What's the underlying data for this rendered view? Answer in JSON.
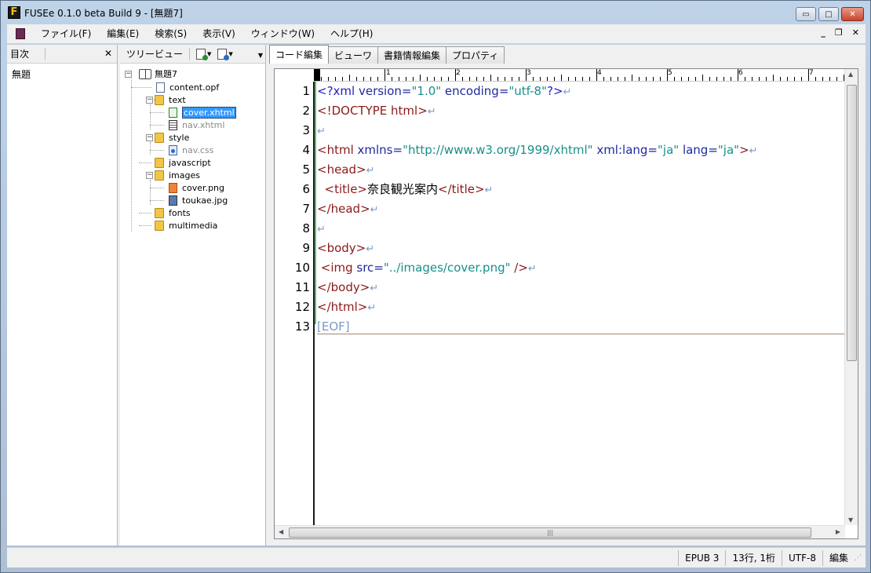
{
  "window": {
    "title": "FUSEe 0.1.0 beta Build 9 - [無題7]",
    "app_icon_letter": "F",
    "minimize_glyph": "▭",
    "maximize_glyph": "□",
    "close_glyph": "✕"
  },
  "menu": {
    "items": [
      "ファイル(F)",
      "編集(E)",
      "検索(S)",
      "表示(V)",
      "ウィンドウ(W)",
      "ヘルプ(H)"
    ],
    "mdi_min": "_",
    "mdi_restore": "❐",
    "mdi_close": "✕"
  },
  "toc": {
    "header": "目次",
    "close_glyph": "✕",
    "items": [
      "無題"
    ]
  },
  "tree": {
    "header": "ツリービュー",
    "root": "無題7",
    "nodes": {
      "content": "content.opf",
      "text": "text",
      "cover": "cover.xhtml",
      "nav": "nav.xhtml",
      "style": "style",
      "navcss": "nav.css",
      "javascript": "javascript",
      "images": "images",
      "coverpng": "cover.png",
      "toukae": "toukae.jpg",
      "fonts": "fonts",
      "multimedia": "multimedia"
    }
  },
  "tabs": [
    "コード編集",
    "ビューワ",
    "書籍情報編集",
    "プロパティ"
  ],
  "editor": {
    "ruler_marks": [
      "1",
      "2",
      "3",
      "4",
      "5",
      "6",
      "7"
    ],
    "line_numbers": [
      "1",
      "2",
      "3",
      "4",
      "5",
      "6",
      "7",
      "8",
      "9",
      "10",
      "11",
      "12",
      "13"
    ],
    "eol": "↵",
    "lines": {
      "l1": {
        "a": "<?xml ",
        "b": "version",
        "c": "=",
        "d": "\"1.0\"",
        "e": " encoding",
        "f": "=",
        "g": "\"utf-8\"",
        "h": "?>"
      },
      "l2": {
        "a": "<!DOCTYPE html>"
      },
      "l4": {
        "a": "<html ",
        "b": "xmlns",
        "c": "=",
        "d": "\"http://www.w3.org/1999/xhtml\"",
        "e": " xml:lang",
        "f": "=",
        "g": "\"ja\"",
        "h": " lang",
        "i": "=",
        "j": "\"ja\"",
        "k": ">"
      },
      "l5": {
        "a": "<head>"
      },
      "l6": {
        "a": "  <title>",
        "b": "奈良観光案内",
        "c": "</title>"
      },
      "l7": {
        "a": "</head>"
      },
      "l9": {
        "a": "<body>"
      },
      "l10": {
        "a": " <img ",
        "b": "src",
        "c": "=",
        "d": "\"../images/cover.png\"",
        "e": " />"
      },
      "l11": {
        "a": "</body>"
      },
      "l12": {
        "a": "</html>"
      },
      "l13": {
        "a": "[EOF]"
      }
    }
  },
  "status": {
    "format": "EPUB 3",
    "position": "13行, 1桁",
    "encoding": "UTF-8",
    "mode": "編集"
  }
}
